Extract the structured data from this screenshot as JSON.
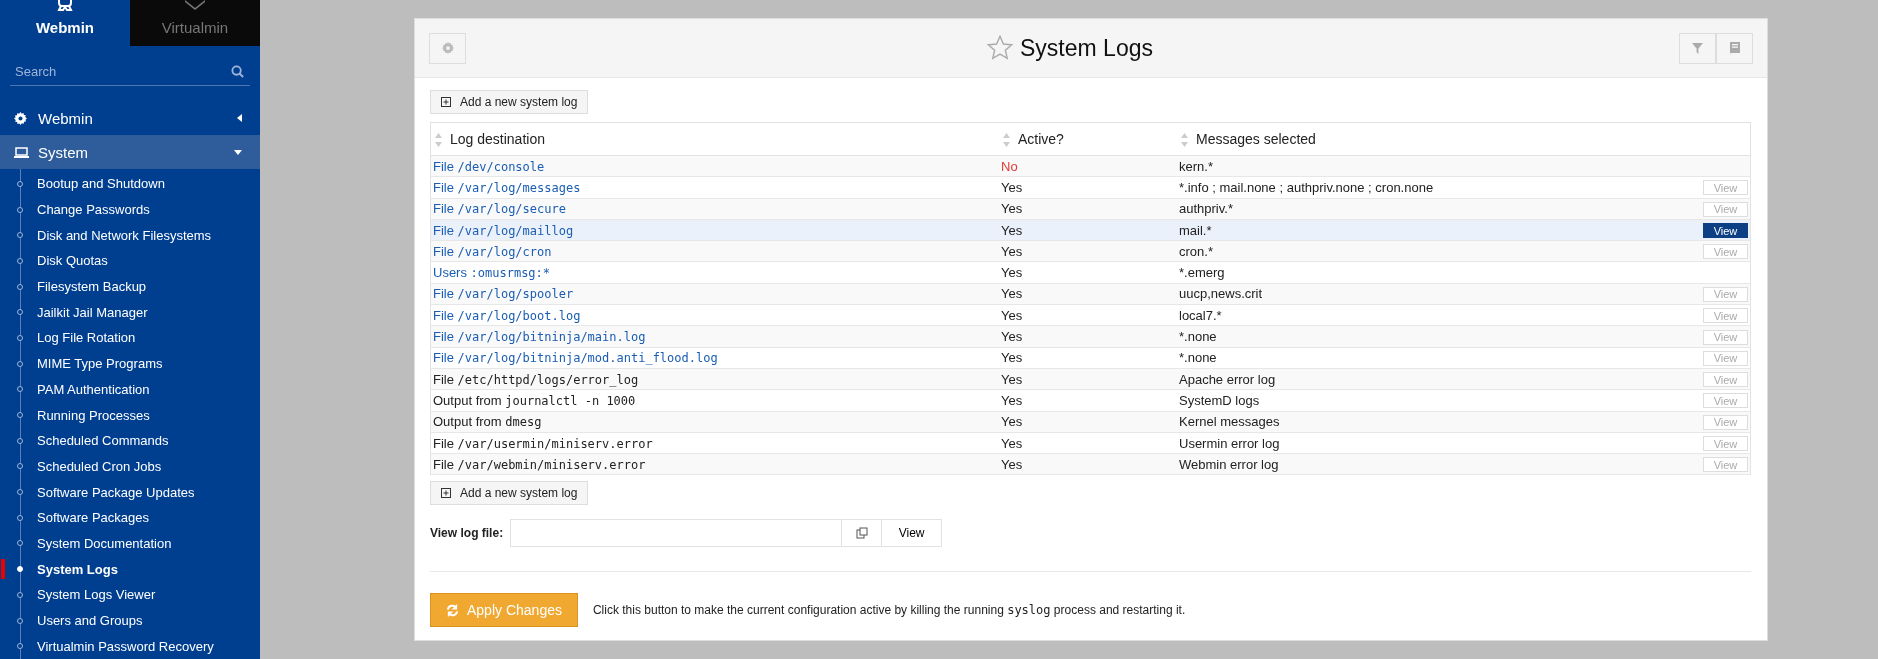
{
  "sidebar": {
    "tabs": [
      {
        "label": "Webmin",
        "selected": true
      },
      {
        "label": "Virtualmin",
        "selected": false
      }
    ],
    "search": {
      "placeholder": "Search"
    },
    "categories": [
      {
        "label": "Webmin",
        "expanded": false
      },
      {
        "label": "System",
        "expanded": true
      }
    ],
    "items": [
      {
        "label": "Bootup and Shutdown",
        "selected": false
      },
      {
        "label": "Change Passwords",
        "selected": false
      },
      {
        "label": "Disk and Network Filesystems",
        "selected": false
      },
      {
        "label": "Disk Quotas",
        "selected": false
      },
      {
        "label": "Filesystem Backup",
        "selected": false
      },
      {
        "label": "Jailkit Jail Manager",
        "selected": false
      },
      {
        "label": "Log File Rotation",
        "selected": false
      },
      {
        "label": "MIME Type Programs",
        "selected": false
      },
      {
        "label": "PAM Authentication",
        "selected": false
      },
      {
        "label": "Running Processes",
        "selected": false
      },
      {
        "label": "Scheduled Commands",
        "selected": false
      },
      {
        "label": "Scheduled Cron Jobs",
        "selected": false
      },
      {
        "label": "Software Package Updates",
        "selected": false
      },
      {
        "label": "Software Packages",
        "selected": false
      },
      {
        "label": "System Documentation",
        "selected": false
      },
      {
        "label": "System Logs",
        "selected": true
      },
      {
        "label": "System Logs Viewer",
        "selected": false
      },
      {
        "label": "Users and Groups",
        "selected": false
      },
      {
        "label": "Virtualmin Password Recovery",
        "selected": false
      }
    ]
  },
  "page": {
    "title": "System Logs",
    "add_button": "Add a new system log",
    "table": {
      "columns": [
        "Log destination",
        "Active?",
        "Messages selected"
      ],
      "rows": [
        {
          "prefix": "File",
          "path": "/dev/console",
          "link": true,
          "active": false,
          "active_text": "No",
          "messages": "kern.*",
          "view": null,
          "highlighted": false
        },
        {
          "prefix": "File",
          "path": "/var/log/messages",
          "link": true,
          "active": true,
          "active_text": "Yes",
          "messages": "*.info ; mail.none ; authpriv.none ; cron.none",
          "view": "View",
          "highlighted": false
        },
        {
          "prefix": "File",
          "path": "/var/log/secure",
          "link": true,
          "active": true,
          "active_text": "Yes",
          "messages": "authpriv.*",
          "view": "View",
          "highlighted": false
        },
        {
          "prefix": "File",
          "path": "/var/log/maillog",
          "link": true,
          "active": true,
          "active_text": "Yes",
          "messages": "mail.*",
          "view": "View",
          "highlighted": true
        },
        {
          "prefix": "File",
          "path": "/var/log/cron",
          "link": true,
          "active": true,
          "active_text": "Yes",
          "messages": "cron.*",
          "view": "View",
          "highlighted": false
        },
        {
          "prefix": "Users",
          "path": ":omusrmsg:*",
          "link": true,
          "active": true,
          "active_text": "Yes",
          "messages": "*.emerg",
          "view": null,
          "highlighted": false
        },
        {
          "prefix": "File",
          "path": "/var/log/spooler",
          "link": true,
          "active": true,
          "active_text": "Yes",
          "messages": "uucp,news.crit",
          "view": "View",
          "highlighted": false
        },
        {
          "prefix": "File",
          "path": "/var/log/boot.log",
          "link": true,
          "active": true,
          "active_text": "Yes",
          "messages": "local7.*",
          "view": "View",
          "highlighted": false
        },
        {
          "prefix": "File",
          "path": "/var/log/bitninja/main.log",
          "link": true,
          "active": true,
          "active_text": "Yes",
          "messages": "*.none",
          "view": "View",
          "highlighted": false
        },
        {
          "prefix": "File",
          "path": "/var/log/bitninja/mod.anti_flood.log",
          "link": true,
          "active": true,
          "active_text": "Yes",
          "messages": "*.none",
          "view": "View",
          "highlighted": false
        },
        {
          "prefix": "File",
          "path": "/etc/httpd/logs/error_log",
          "link": false,
          "active": true,
          "active_text": "Yes",
          "messages": "Apache error log",
          "view": "View",
          "highlighted": false
        },
        {
          "prefix": "Output from",
          "path": "journalctl -n 1000",
          "link": false,
          "active": true,
          "active_text": "Yes",
          "messages": "SystemD logs",
          "view": "View",
          "highlighted": false
        },
        {
          "prefix": "Output from",
          "path": "dmesg",
          "link": false,
          "active": true,
          "active_text": "Yes",
          "messages": "Kernel messages",
          "view": "View",
          "highlighted": false
        },
        {
          "prefix": "File",
          "path": "/var/usermin/miniserv.error",
          "link": false,
          "active": true,
          "active_text": "Yes",
          "messages": "Usermin error log",
          "view": "View",
          "highlighted": false
        },
        {
          "prefix": "File",
          "path": "/var/webmin/miniserv.error",
          "link": false,
          "active": true,
          "active_text": "Yes",
          "messages": "Webmin error log",
          "view": "View",
          "highlighted": false
        }
      ]
    },
    "add_button_bottom": "Add a new system log",
    "view_log": {
      "label": "View log file:",
      "button": "View"
    },
    "apply": {
      "button": "Apply Changes",
      "text": "Click this button to make the current configuration active by killing the running ",
      "command": "syslog",
      "text_after": " process and restarting it."
    }
  }
}
